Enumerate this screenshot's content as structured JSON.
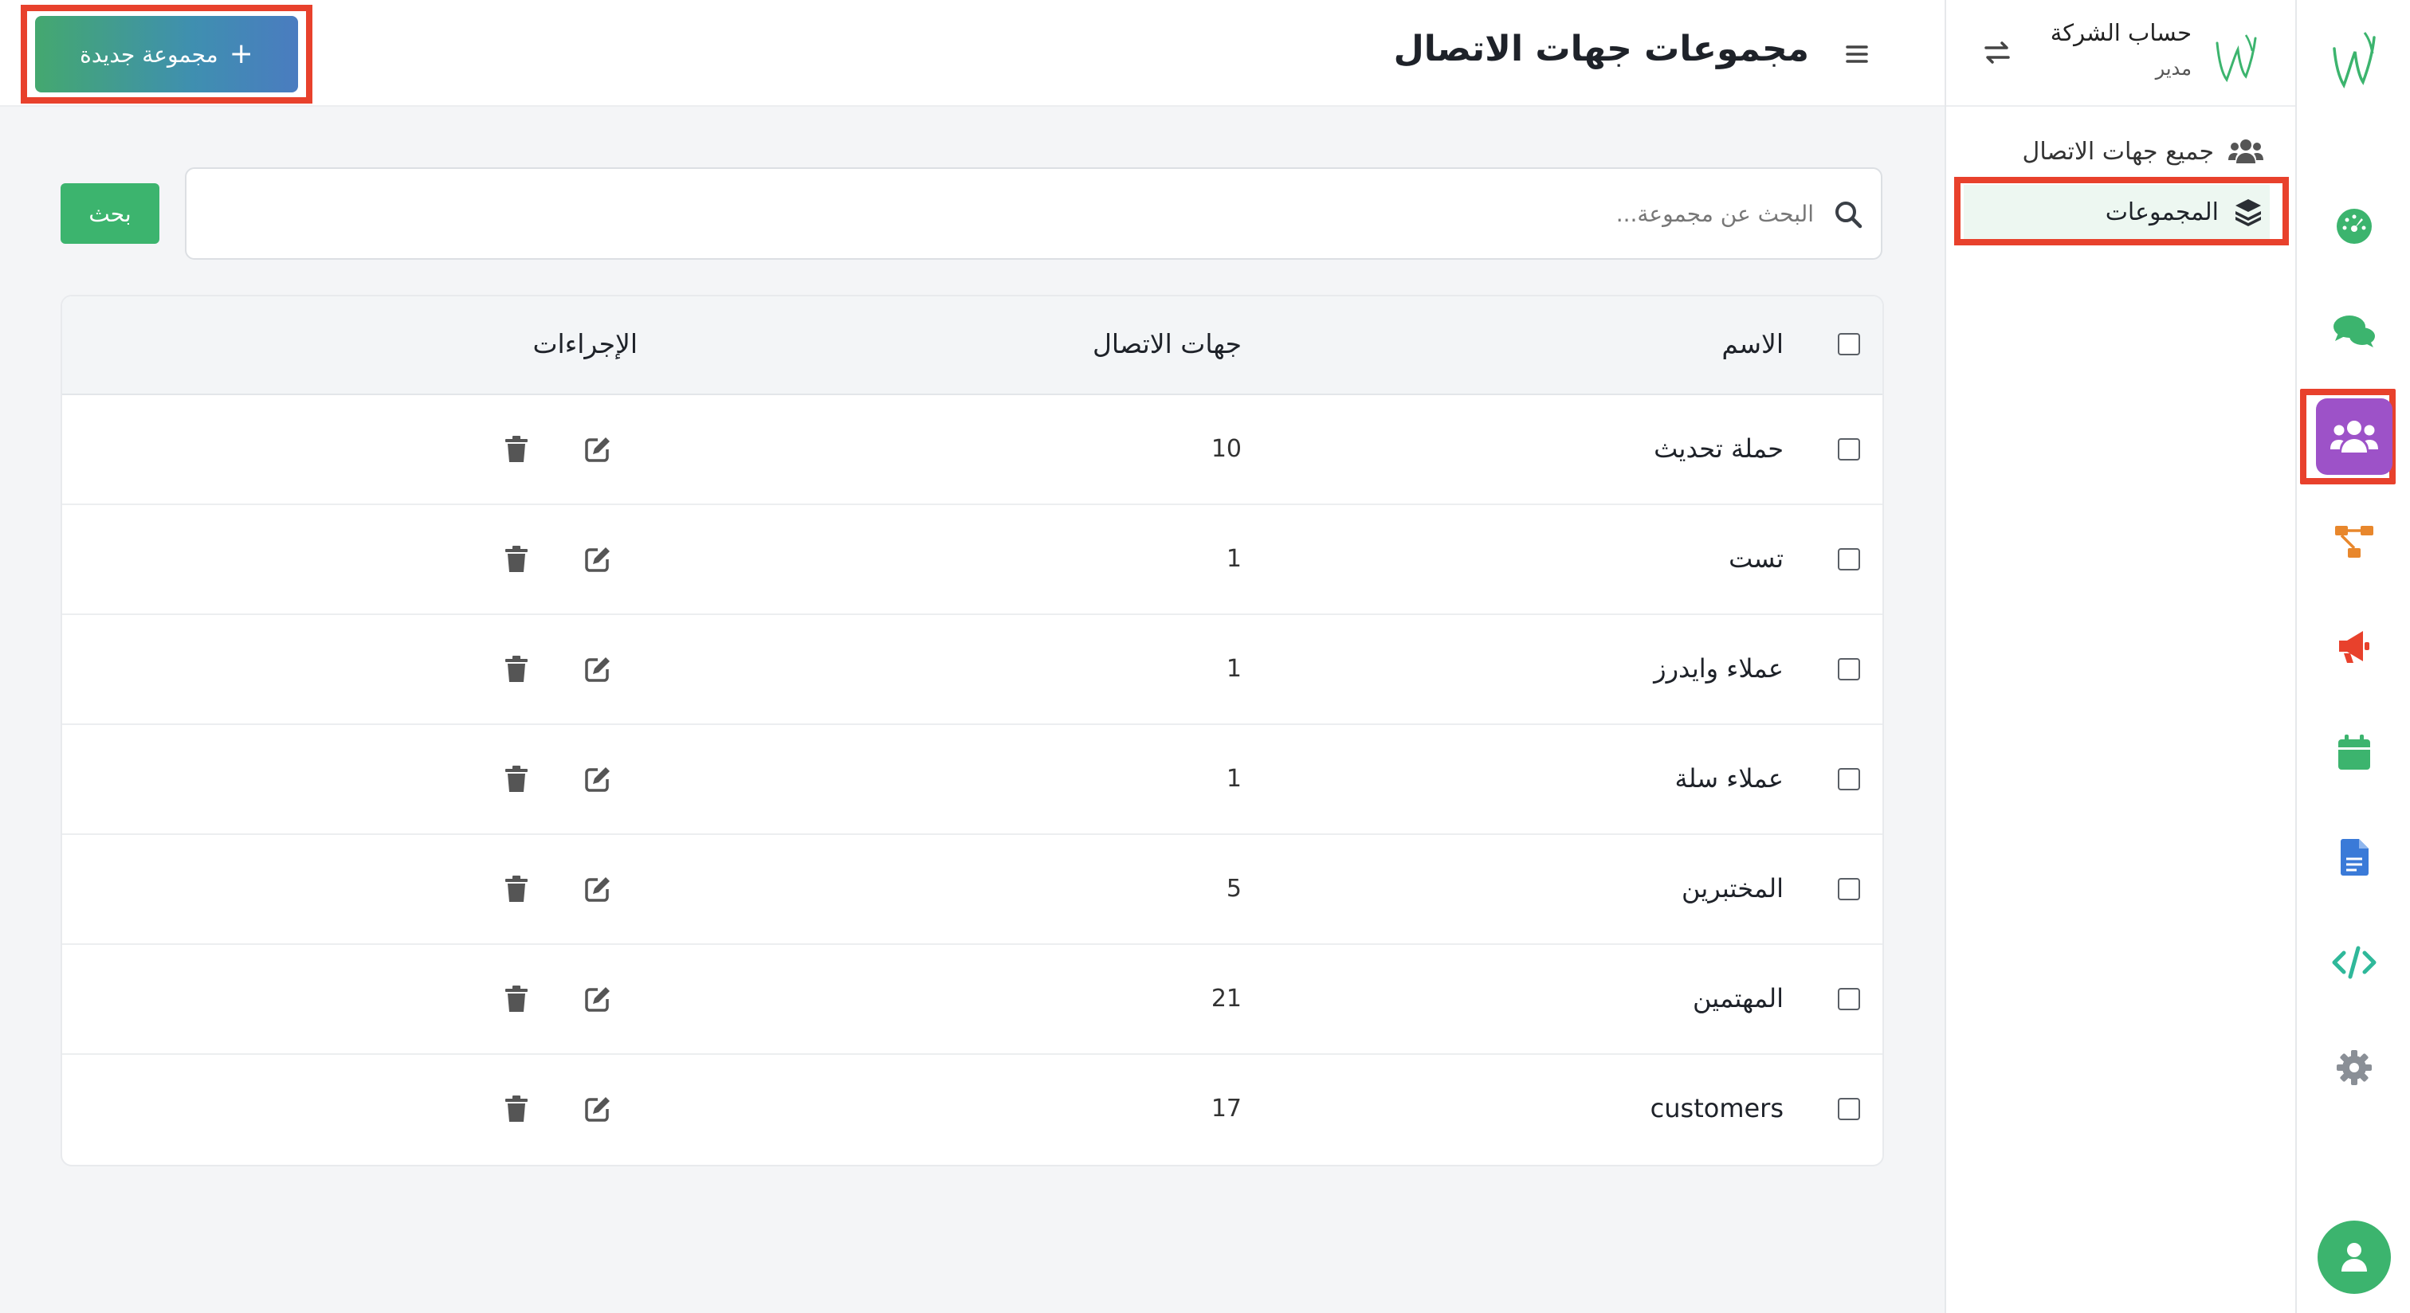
{
  "colors": {
    "accent_green": "#3cb46e",
    "active_purple": "#9d52c8",
    "highlight_red": "#e8412c"
  },
  "account": {
    "name": "حساب الشركة",
    "role": "مدير"
  },
  "rail": {
    "items": [
      {
        "icon": "dashboard-gauge-icon",
        "color": "#3cb46e"
      },
      {
        "icon": "chat-bubbles-icon",
        "color": "#3cb46e"
      },
      {
        "icon": "users-group-icon",
        "color": "#ffffff",
        "active": true
      },
      {
        "icon": "flow-diagram-icon",
        "color": "#e8872c"
      },
      {
        "icon": "megaphone-icon",
        "color": "#e8412c"
      },
      {
        "icon": "calendar-icon",
        "color": "#3cb46e"
      },
      {
        "icon": "document-icon",
        "color": "#3a7ad8"
      },
      {
        "icon": "code-icon",
        "color": "#2fb89a"
      },
      {
        "icon": "gear-icon",
        "color": "#8a8f96"
      }
    ]
  },
  "subnav": {
    "items": [
      {
        "label": "جميع جهات الاتصال",
        "icon": "users-icon"
      },
      {
        "label": "المجموعات",
        "icon": "layers-icon",
        "active": true
      }
    ]
  },
  "header": {
    "title": "مجموعات جهات الاتصال",
    "new_button": "مجموعة جديدة",
    "new_button_icon": "+"
  },
  "search": {
    "placeholder": "البحث عن مجموعة...",
    "value": "",
    "button": "بحث"
  },
  "table": {
    "columns": {
      "name": "الاسم",
      "contacts": "جهات الاتصال",
      "actions": "الإجراءات"
    },
    "rows": [
      {
        "name": "حملة تحديث",
        "contacts": "10"
      },
      {
        "name": "تست",
        "contacts": "1"
      },
      {
        "name": "عملاء وايدرز",
        "contacts": "1"
      },
      {
        "name": "عملاء سلة",
        "contacts": "1"
      },
      {
        "name": "المختبرين",
        "contacts": "5"
      },
      {
        "name": "المهتمين",
        "contacts": "21"
      },
      {
        "name": "customers",
        "contacts": "17"
      }
    ]
  }
}
